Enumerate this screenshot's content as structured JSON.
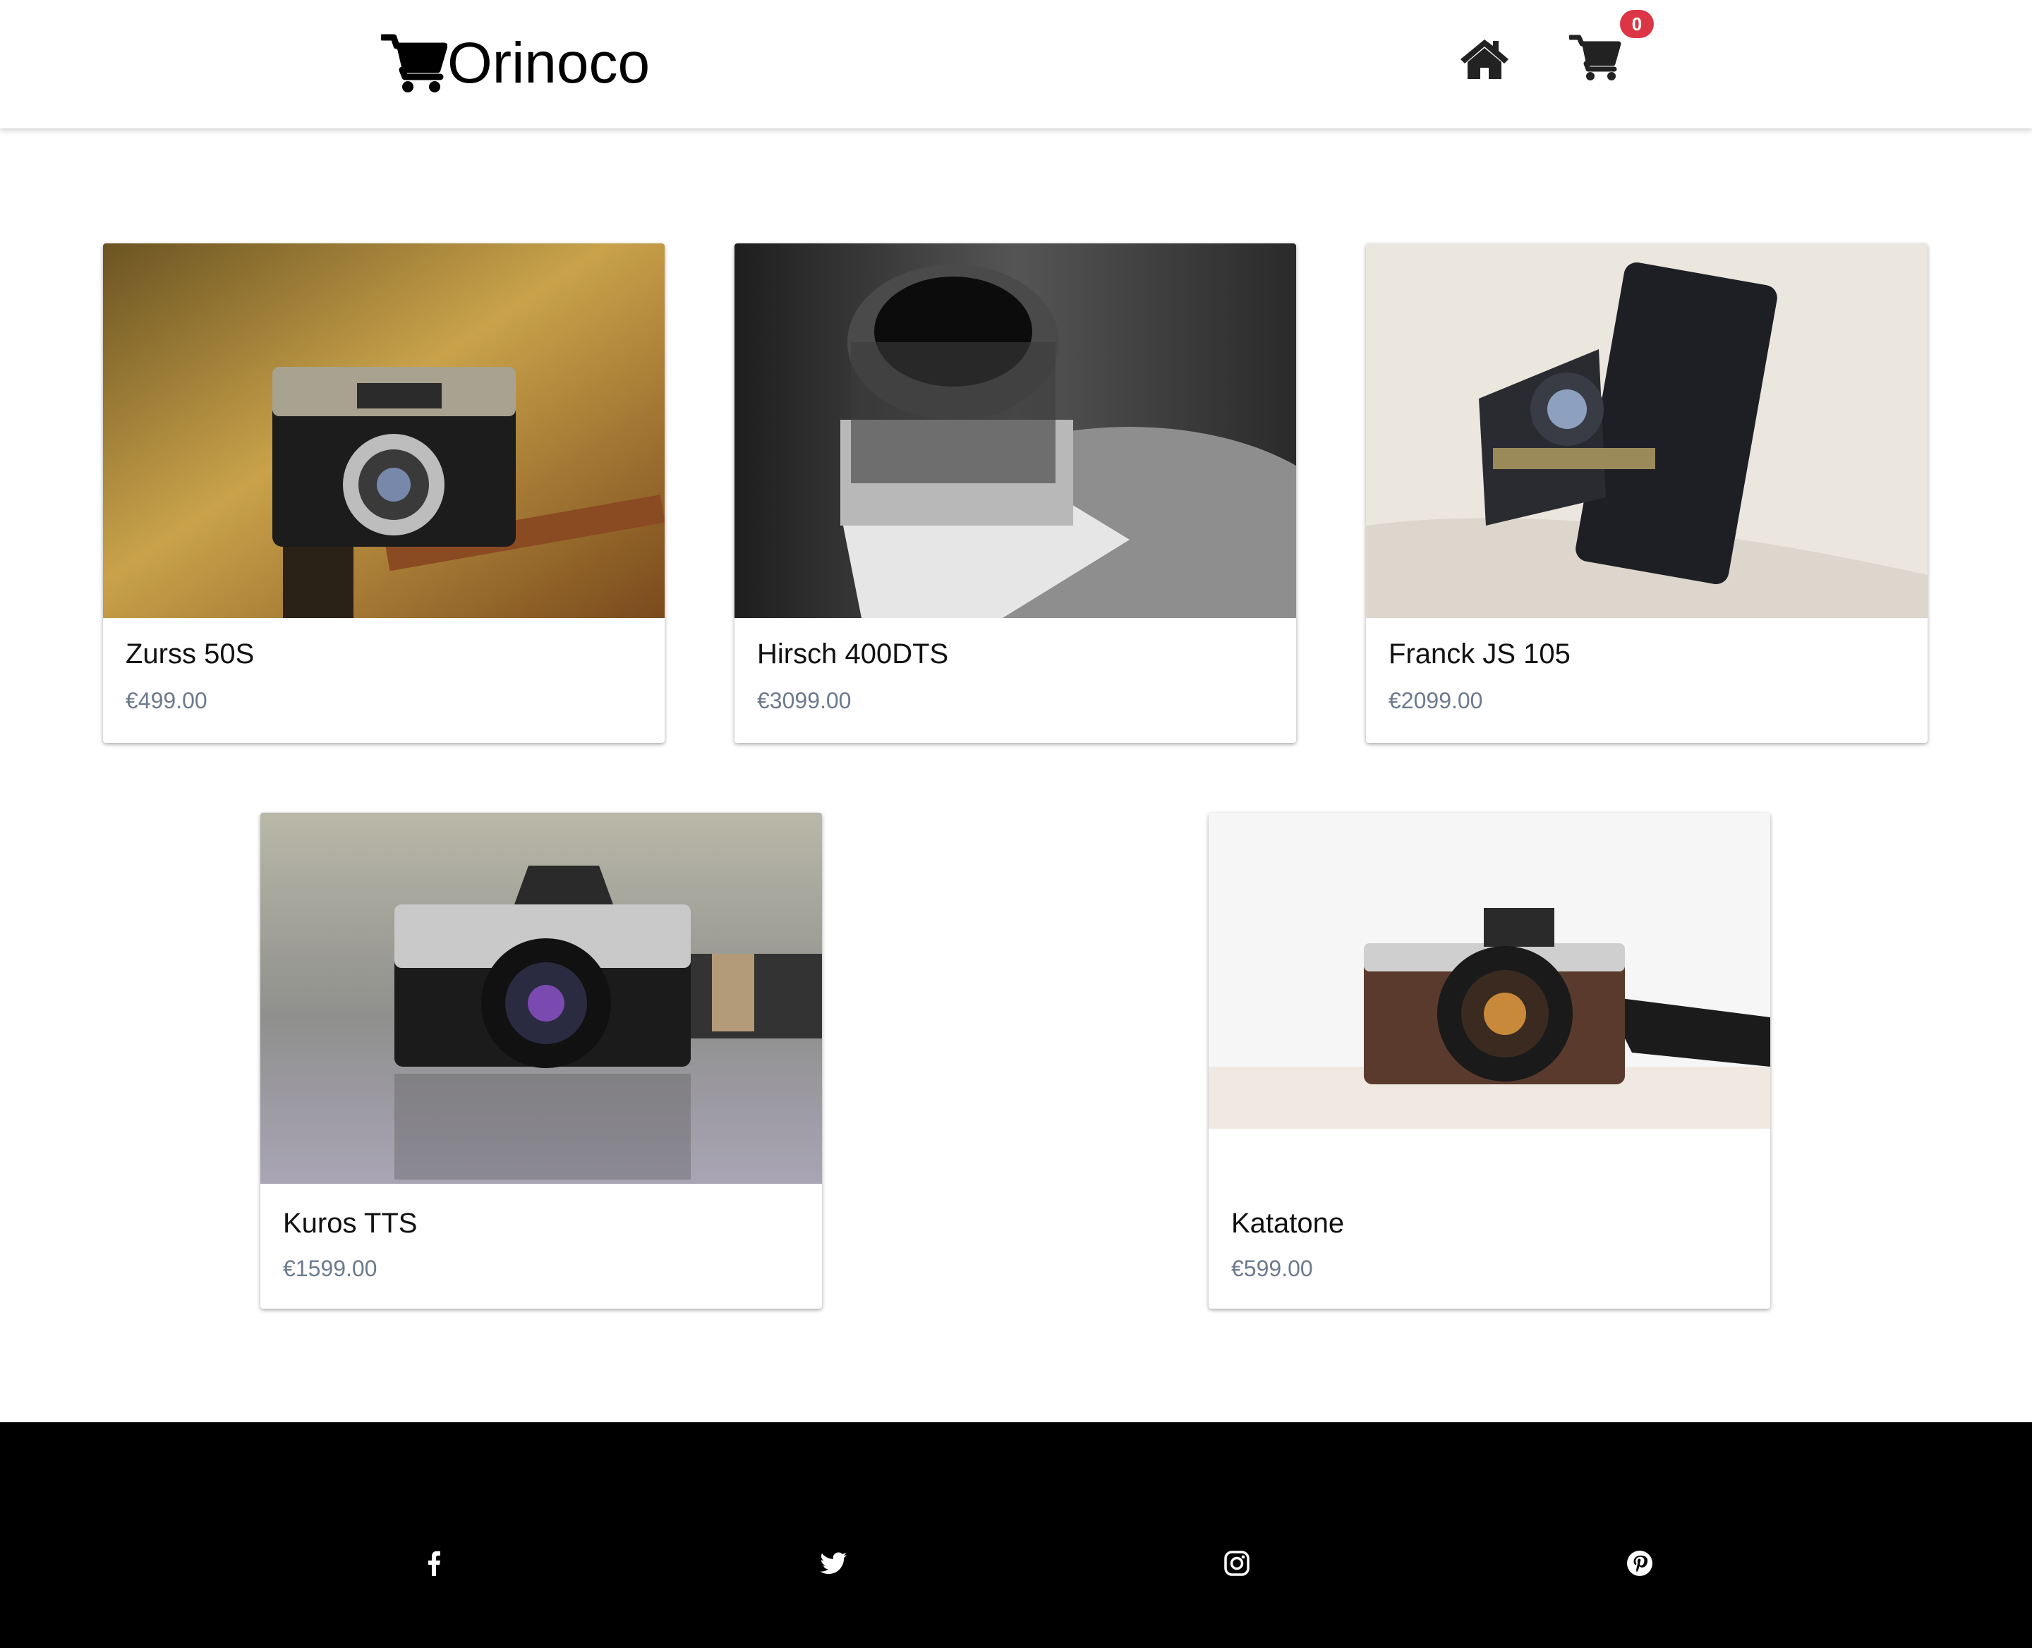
{
  "header": {
    "brand_name": "Orinoco",
    "brand_icon": "cart-icon",
    "nav_icons": [
      "home-icon",
      "cart-icon"
    ],
    "cart_count": "0"
  },
  "products": [
    {
      "name": "Zurss 50S",
      "price": "€499.00"
    },
    {
      "name": "Hirsch 400DTS",
      "price": "€3099.00"
    },
    {
      "name": "Franck JS 105",
      "price": "€2099.00"
    },
    {
      "name": "Kuros TTS",
      "price": "€1599.00"
    },
    {
      "name": "Katatone",
      "price": "€599.00"
    }
  ],
  "footer": {
    "social_icons": [
      "facebook-icon",
      "twitter-icon",
      "instagram-icon",
      "pinterest-icon"
    ]
  },
  "colors": {
    "badge": "#dc3545",
    "price_text": "#6c7a8d",
    "footer_bg": "#000000"
  }
}
